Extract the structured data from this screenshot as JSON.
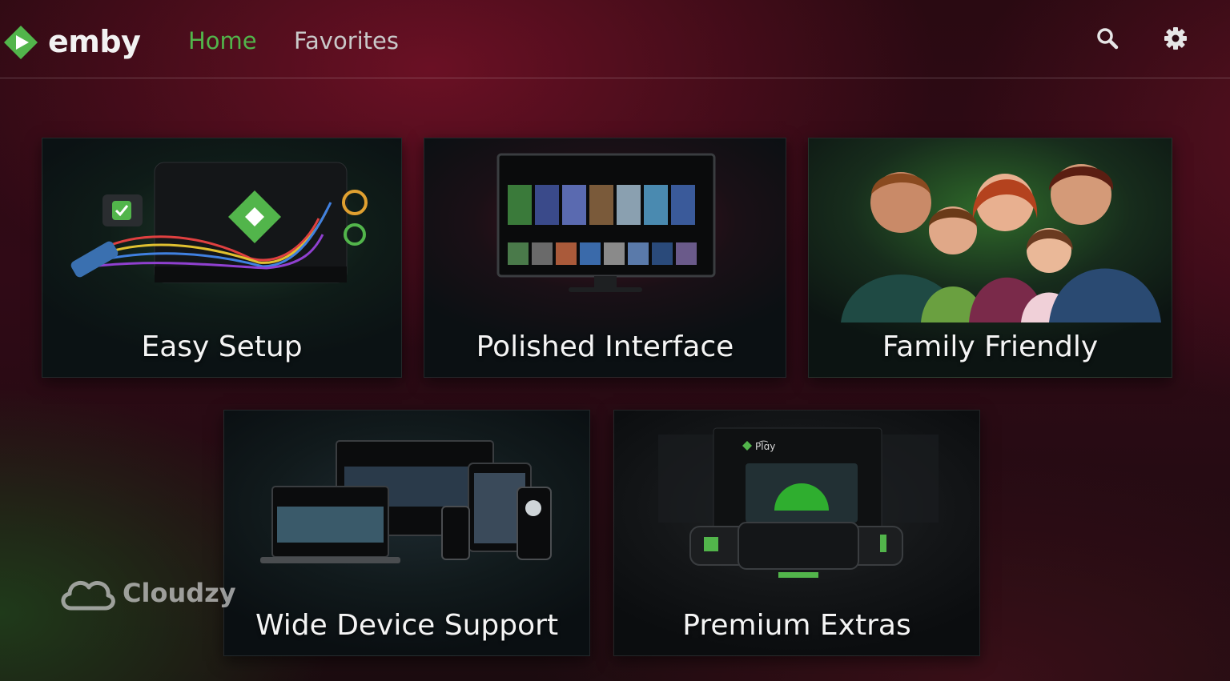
{
  "app": {
    "logo_text": "emby",
    "brand_color": "#52b54b",
    "logo_icon": "emby-play-icon"
  },
  "nav": {
    "home_label": "Home",
    "favorites_label": "Favorites",
    "active": "Home",
    "active_color": "#52b54b",
    "inactive_color": "#c9c9c9"
  },
  "header_actions": {
    "search_icon": "search-icon",
    "settings_icon": "gear-icon"
  },
  "tiles": [
    {
      "label": "Easy Setup",
      "icon": "setup-device-illustration"
    },
    {
      "label": "Polished Interface",
      "icon": "tv-interface-illustration"
    },
    {
      "label": "Family Friendly",
      "icon": "family-photo"
    },
    {
      "label": "Wide Device Support",
      "icon": "devices-illustration"
    },
    {
      "label": "Premium Extras",
      "icon": "premium-controller-illustration"
    }
  ],
  "watermark": {
    "text": "Cloudzy",
    "icon": "cloud-icon"
  },
  "art_text": {
    "premium_screen_logo": "Pl͡ɑy"
  }
}
